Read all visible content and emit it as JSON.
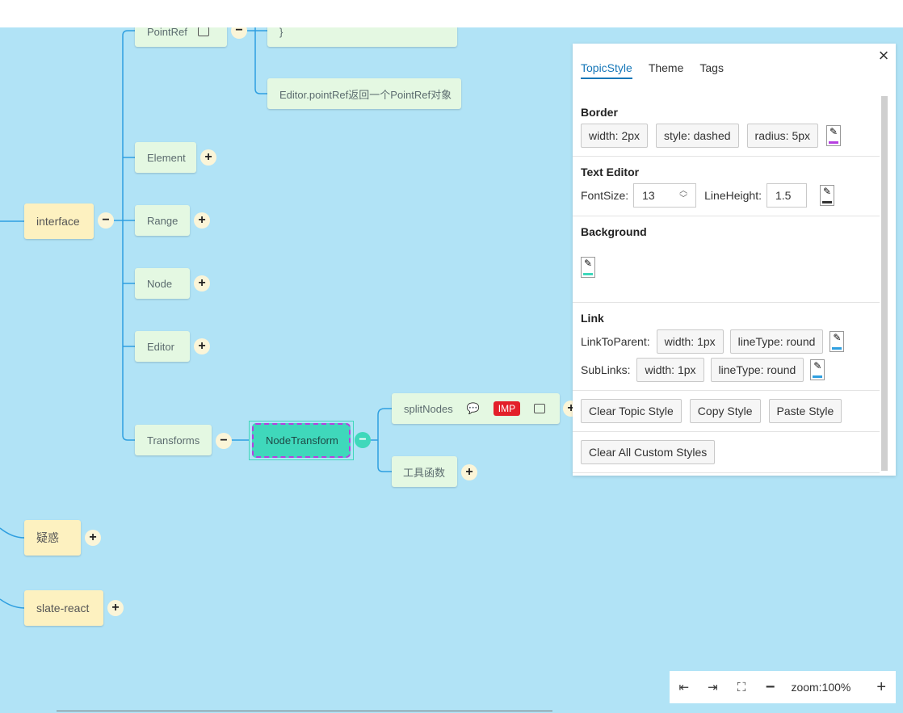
{
  "mindmap": {
    "nodes": {
      "pointref": "PointRef",
      "code_end": "}",
      "pointref_desc": "Editor.pointRef返回一个PointRef对象",
      "element": "Element",
      "range": "Range",
      "node": "Node",
      "editor": "Editor",
      "transforms": "Transforms",
      "node_transform": "NodeTransform",
      "split_nodes": "splitNodes",
      "imp_badge": "IMP",
      "tools": "工具函数",
      "interface": "interface",
      "doubts": "疑惑",
      "slate_react": "slate-react"
    },
    "colors": {
      "canvas": "#b1e3f6",
      "line": "#2f9fe0",
      "selected_node": "#3fd8bb",
      "selected_border": "#b63fe0"
    }
  },
  "panel": {
    "tabs": [
      "TopicStyle",
      "Theme",
      "Tags"
    ],
    "active_tab": "TopicStyle",
    "border": {
      "title": "Border",
      "width": "width: 2px",
      "style": "style: dashed",
      "radius": "radius: 5px",
      "color": "#b63fe0"
    },
    "text_editor": {
      "title": "Text Editor",
      "font_size_label": "FontSize:",
      "font_size_value": "13",
      "line_height_label": "LineHeight:",
      "line_height_value": "1.5",
      "color": "#333333"
    },
    "background": {
      "title": "Background",
      "color": "#3fd8bb"
    },
    "link": {
      "title": "Link",
      "to_parent_label": "LinkToParent:",
      "to_parent_width": "width: 1px",
      "to_parent_linetype": "lineType: round",
      "sub_links_label": "SubLinks:",
      "sub_links_width": "width: 1px",
      "sub_links_linetype": "lineType: round",
      "color": "#2f9fe0"
    },
    "actions": {
      "clear_topic_style": "Clear Topic Style",
      "copy_style": "Copy Style",
      "paste_style": "Paste Style",
      "clear_all": "Clear All Custom Styles"
    }
  },
  "zoom": {
    "label": "zoom:100%"
  }
}
